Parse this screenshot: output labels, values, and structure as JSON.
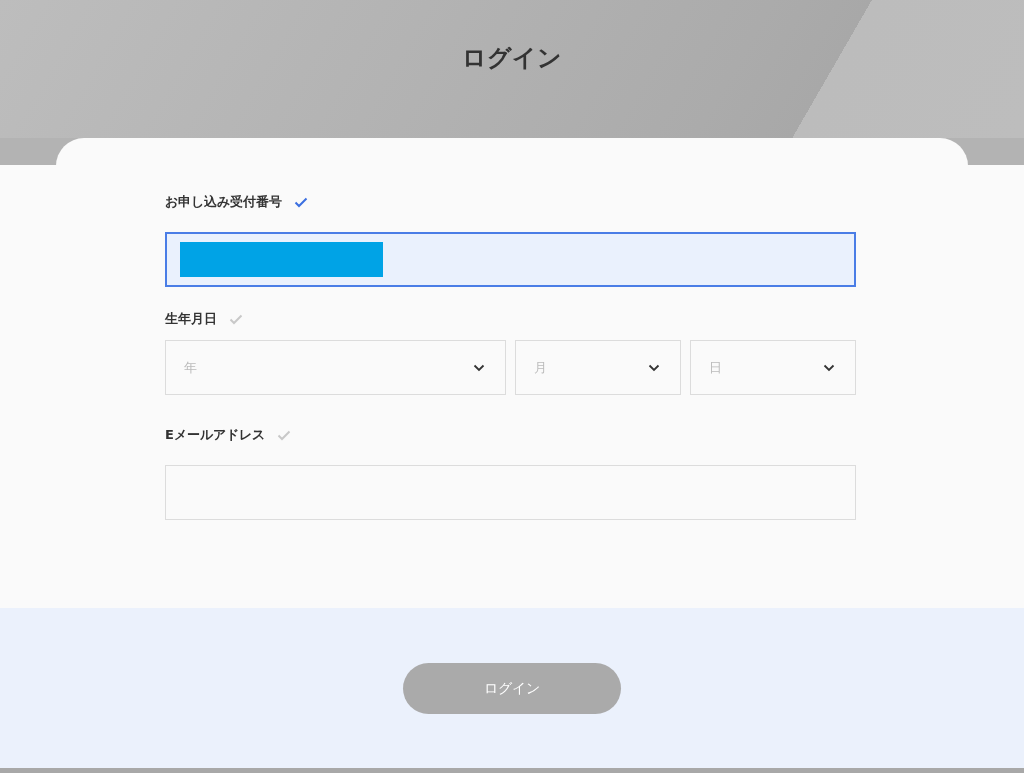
{
  "header": {
    "title": "ログイン"
  },
  "form": {
    "fields": [
      {
        "kind": "text",
        "label": "お申し込み受付番号",
        "valid": true,
        "focused": true,
        "redacted": true
      },
      {
        "kind": "date",
        "label": "生年月日",
        "valid": false,
        "selects": [
          {
            "placeholder": "年"
          },
          {
            "placeholder": "月"
          },
          {
            "placeholder": "日"
          }
        ]
      },
      {
        "kind": "text",
        "label": "Eメールアドレス",
        "valid": false,
        "focused": false,
        "redacted": false
      }
    ]
  },
  "login_button": {
    "label": "ログイン",
    "disabled": true
  }
}
